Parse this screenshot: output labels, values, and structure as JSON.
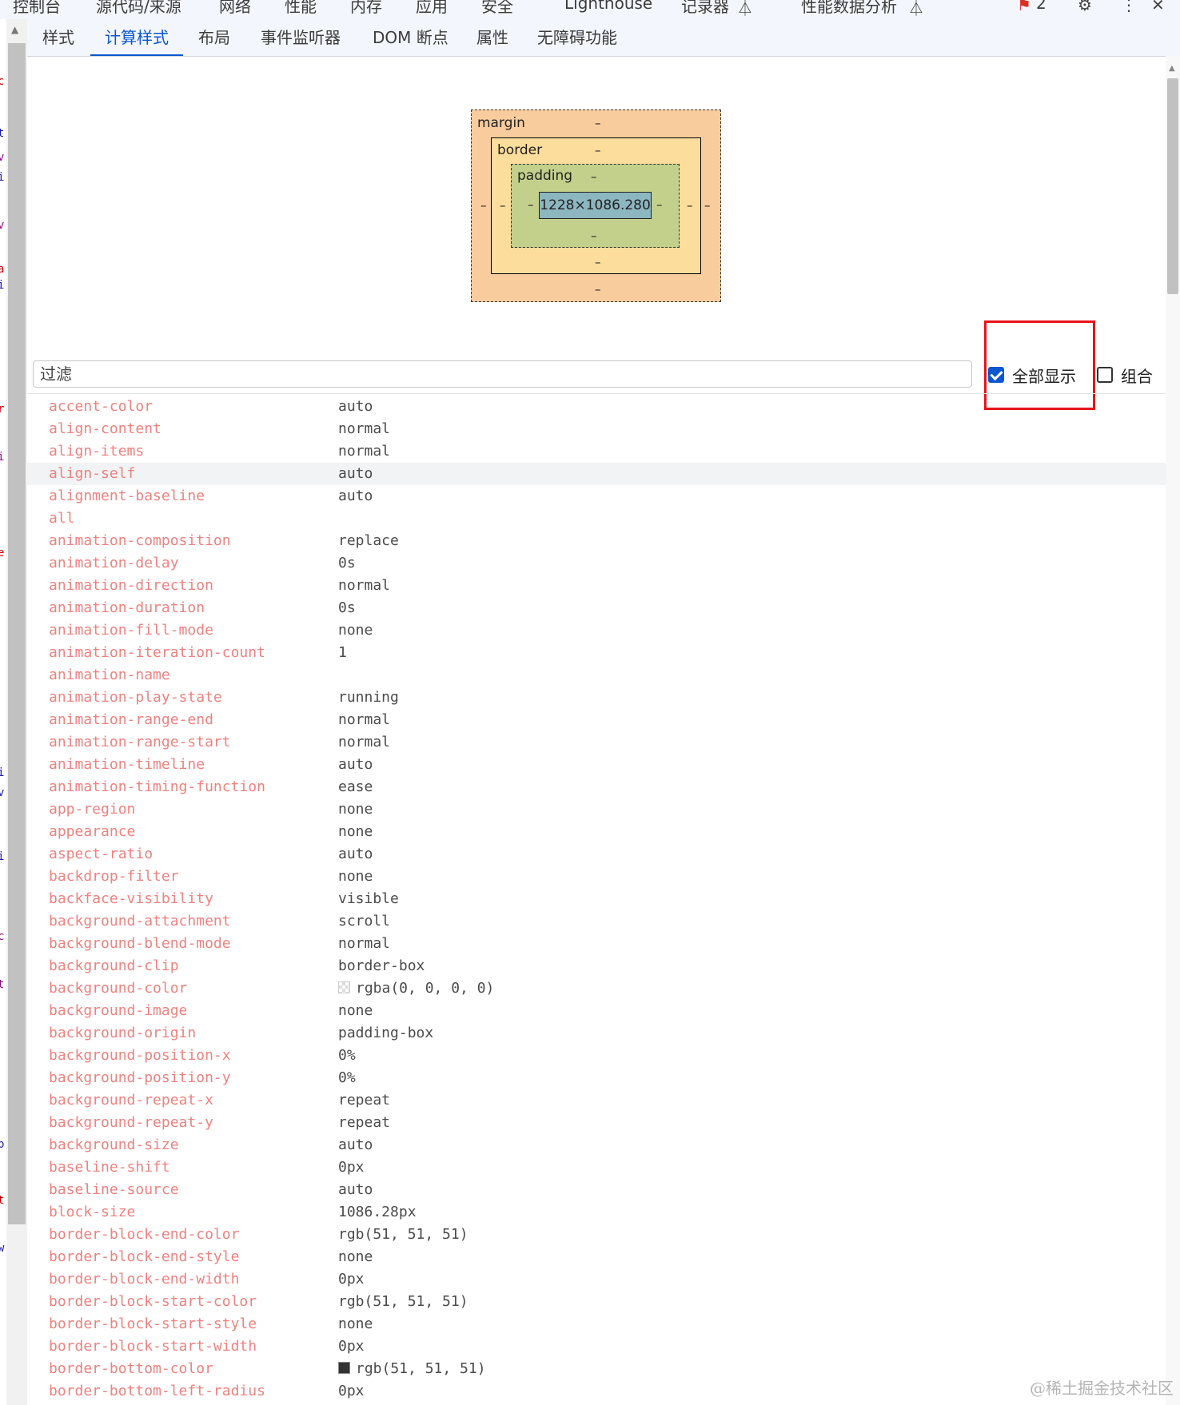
{
  "main_toolbar": {
    "tabs": [
      "控制台",
      "源代码/来源",
      "网络",
      "性能",
      "内存",
      "应用",
      "安全",
      "Lighthouse",
      "记录器",
      "性能数据分析"
    ],
    "issues_count": "2",
    "icons": [
      "flask-icon",
      "flask-icon",
      "issues-flag-icon",
      "settings-gear-icon",
      "more-vert-icon",
      "close-icon"
    ]
  },
  "subtabs": [
    "样式",
    "计算样式",
    "布局",
    "事件监听器",
    "DOM 断点",
    "属性",
    "无障碍功能"
  ],
  "active_subtab": "计算样式",
  "box_model": {
    "margin_label": "margin",
    "border_label": "border",
    "padding_label": "padding",
    "content_size": "1228×1086.280",
    "dash": "–"
  },
  "filter": {
    "placeholder": "过滤",
    "show_all_label": "全部显示",
    "show_all_checked": true,
    "group_label": "组合",
    "group_checked": false
  },
  "highlight_color": "#e8141b",
  "property_name_color": "#ee827f",
  "properties": [
    {
      "name": "accent-color",
      "value": "auto"
    },
    {
      "name": "align-content",
      "value": "normal"
    },
    {
      "name": "align-items",
      "value": "normal"
    },
    {
      "name": "align-self",
      "value": "auto",
      "hovered": true
    },
    {
      "name": "alignment-baseline",
      "value": "auto"
    },
    {
      "name": "all",
      "value": ""
    },
    {
      "name": "animation-composition",
      "value": "replace"
    },
    {
      "name": "animation-delay",
      "value": "0s"
    },
    {
      "name": "animation-direction",
      "value": "normal"
    },
    {
      "name": "animation-duration",
      "value": "0s"
    },
    {
      "name": "animation-fill-mode",
      "value": "none"
    },
    {
      "name": "animation-iteration-count",
      "value": "1"
    },
    {
      "name": "animation-name",
      "value": ""
    },
    {
      "name": "animation-play-state",
      "value": "running"
    },
    {
      "name": "animation-range-end",
      "value": "normal"
    },
    {
      "name": "animation-range-start",
      "value": "normal"
    },
    {
      "name": "animation-timeline",
      "value": "auto"
    },
    {
      "name": "animation-timing-function",
      "value": "ease"
    },
    {
      "name": "app-region",
      "value": "none"
    },
    {
      "name": "appearance",
      "value": "none"
    },
    {
      "name": "aspect-ratio",
      "value": "auto"
    },
    {
      "name": "backdrop-filter",
      "value": "none"
    },
    {
      "name": "backface-visibility",
      "value": "visible"
    },
    {
      "name": "background-attachment",
      "value": "scroll"
    },
    {
      "name": "background-blend-mode",
      "value": "normal"
    },
    {
      "name": "background-clip",
      "value": "border-box"
    },
    {
      "name": "background-color",
      "value": "rgba(0, 0, 0, 0)",
      "swatch": "transparent"
    },
    {
      "name": "background-image",
      "value": "none"
    },
    {
      "name": "background-origin",
      "value": "padding-box"
    },
    {
      "name": "background-position-x",
      "value": "0%"
    },
    {
      "name": "background-position-y",
      "value": "0%"
    },
    {
      "name": "background-repeat-x",
      "value": "repeat"
    },
    {
      "name": "background-repeat-y",
      "value": "repeat"
    },
    {
      "name": "background-size",
      "value": "auto"
    },
    {
      "name": "baseline-shift",
      "value": "0px"
    },
    {
      "name": "baseline-source",
      "value": "auto"
    },
    {
      "name": "block-size",
      "value": "1086.28px"
    },
    {
      "name": "border-block-end-color",
      "value": "rgb(51, 51, 51)"
    },
    {
      "name": "border-block-end-style",
      "value": "none"
    },
    {
      "name": "border-block-end-width",
      "value": "0px"
    },
    {
      "name": "border-block-start-color",
      "value": "rgb(51, 51, 51)"
    },
    {
      "name": "border-block-start-style",
      "value": "none"
    },
    {
      "name": "border-block-start-width",
      "value": "0px"
    },
    {
      "name": "border-bottom-color",
      "value": "rgb(51, 51, 51)",
      "swatch": "dark"
    },
    {
      "name": "border-bottom-left-radius",
      "value": "0px"
    }
  ],
  "watermark": "@稀土掘金技术社区"
}
